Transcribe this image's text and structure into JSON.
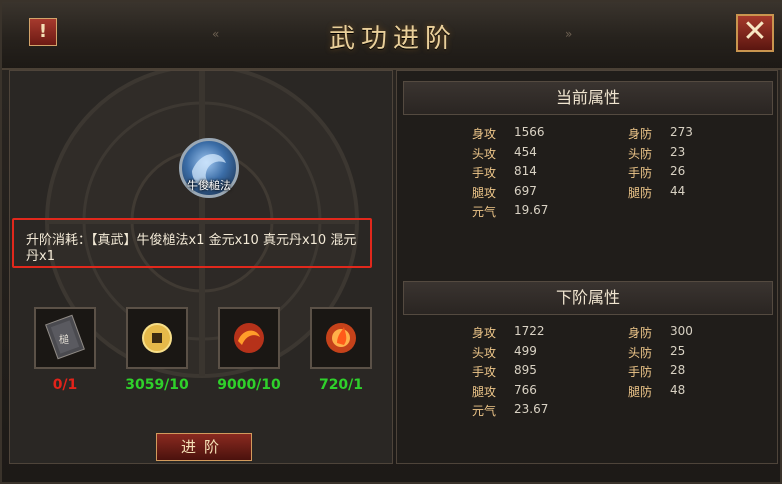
{
  "window": {
    "title": "武功进阶",
    "info_label": "!",
    "close_label": "✕"
  },
  "skill": {
    "name": "牛俊槌法",
    "icon": "skill-orb-icon"
  },
  "cost": {
    "text": "升阶消耗：【真武】牛俊槌法x1 金元x10 真元丹x10 混元丹x1"
  },
  "items": [
    {
      "icon": "book-icon",
      "count": "0/1",
      "color": "#e2231a"
    },
    {
      "icon": "gold-coin-icon",
      "count": "3059/10",
      "color": "#2fd12b"
    },
    {
      "icon": "fire-pill-icon",
      "count": "9000/10",
      "color": "#2fd12b"
    },
    {
      "icon": "fire-orb-icon",
      "count": "720/1",
      "color": "#2fd12b"
    }
  ],
  "advance_button": "进阶",
  "current": {
    "header": "当前属性",
    "left": [
      {
        "label": "身攻",
        "value": "1566"
      },
      {
        "label": "头攻",
        "value": "454"
      },
      {
        "label": "手攻",
        "value": "814"
      },
      {
        "label": "腿攻",
        "value": "697"
      },
      {
        "label": "元气",
        "value": "19.67"
      }
    ],
    "right": [
      {
        "label": "身防",
        "value": "273"
      },
      {
        "label": "头防",
        "value": "23"
      },
      {
        "label": "手防",
        "value": "26"
      },
      {
        "label": "腿防",
        "value": "44"
      }
    ]
  },
  "next": {
    "header": "下阶属性",
    "left": [
      {
        "label": "身攻",
        "value": "1722"
      },
      {
        "label": "头攻",
        "value": "499"
      },
      {
        "label": "手攻",
        "value": "895"
      },
      {
        "label": "腿攻",
        "value": "766"
      },
      {
        "label": "元气",
        "value": "23.67"
      }
    ],
    "right": [
      {
        "label": "身防",
        "value": "300"
      },
      {
        "label": "头防",
        "value": "25"
      },
      {
        "label": "手防",
        "value": "28"
      },
      {
        "label": "腿防",
        "value": "48"
      }
    ]
  }
}
